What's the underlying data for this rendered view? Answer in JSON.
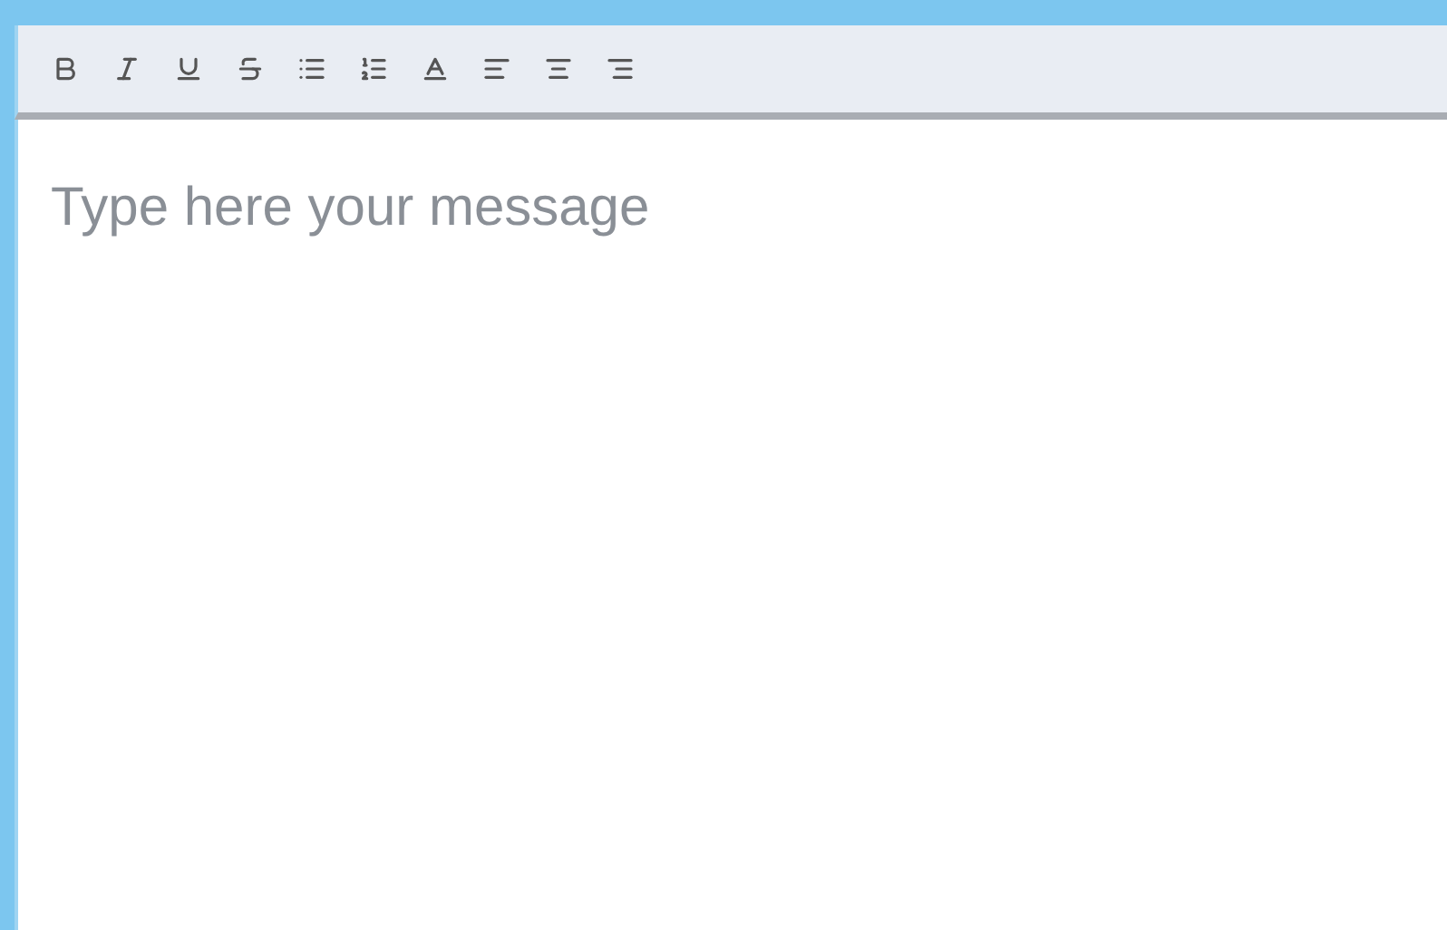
{
  "editor": {
    "placeholder": "Type here your message"
  }
}
